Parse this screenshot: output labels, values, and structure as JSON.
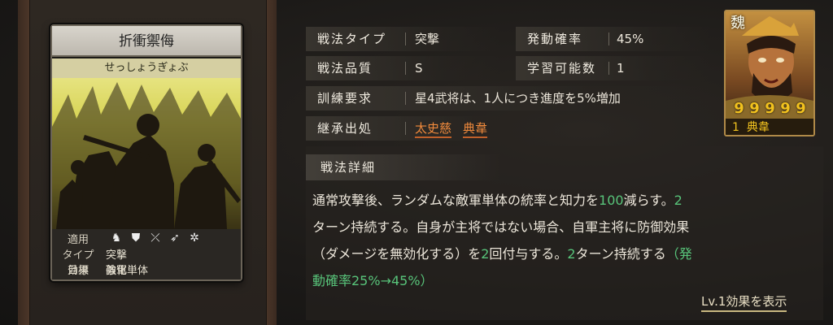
{
  "card": {
    "title": "折衝禦侮",
    "furigana": "せっしょうぎょぶ",
    "stats": [
      {
        "key": "適用",
        "value": ""
      },
      {
        "key": "タイプ",
        "value": "突撃"
      },
      {
        "key": "効果",
        "value": "強化"
      },
      {
        "key": "目標",
        "value": "敵軍単体"
      }
    ],
    "apply_icons": [
      "horse-icon",
      "shield-icon",
      "bow-icon",
      "spear-icon",
      "wheel-icon"
    ]
  },
  "info": {
    "type_label": "戦法タイプ",
    "type_value": "突撃",
    "rate_label": "発動確率",
    "rate_value": "45%",
    "quality_label": "戦法品質",
    "quality_value": "S",
    "learn_label": "学習可能数",
    "learn_value": "1",
    "training_label": "訓練要求",
    "training_value": "星4武将は、1人につき進度を5%増加",
    "inherit_label": "継承出処",
    "inherit_values": [
      "太史慈",
      "典韋"
    ]
  },
  "detail": {
    "heading": "戦法詳細",
    "lines": [
      [
        "通常攻撃後、ランダムな敵軍単体の統率と知力を",
        "100",
        "減らす。",
        "2",
        ""
      ],
      [
        "ターン持続する。自身が主将ではない場合、自軍主将に防御効果",
        "",
        "",
        "",
        ""
      ],
      [
        "（ダメージを無効化する）を",
        "2",
        "回付与する。",
        "2",
        "ターン持続する",
        "（発"
      ],
      [
        "動確率25%→45%）",
        "",
        "",
        "",
        ""
      ]
    ],
    "level_link": "Lv.1効果を表示"
  },
  "portrait": {
    "faction": "魏",
    "stars": [
      "9",
      "9",
      "9",
      "9",
      "9"
    ],
    "level": "1",
    "name": "典韋",
    "colors": {
      "star": "#f2c21e",
      "frame": "#b08a48"
    }
  }
}
